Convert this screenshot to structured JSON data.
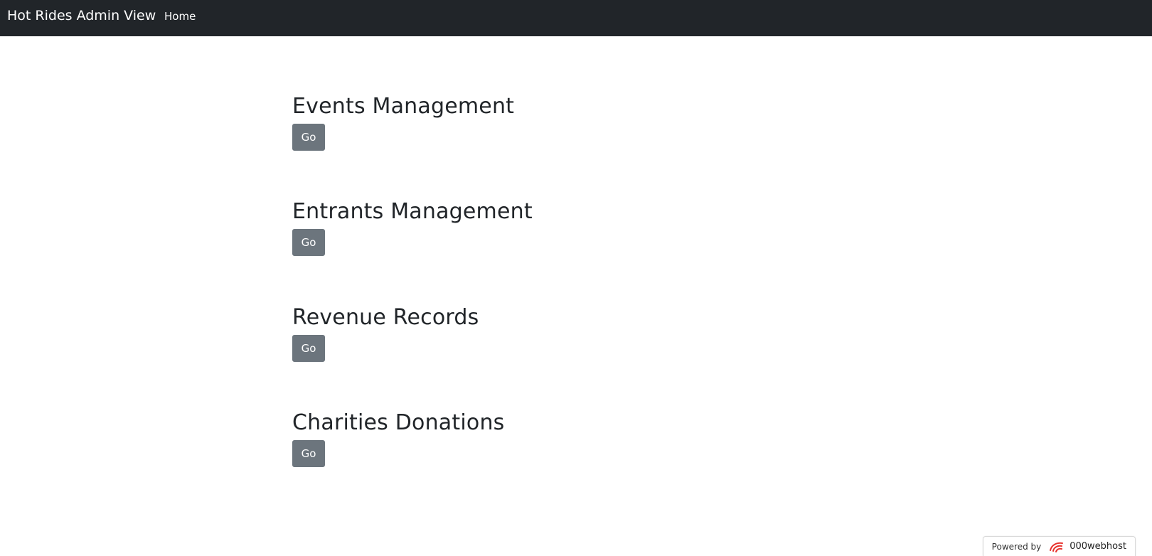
{
  "navbar": {
    "brand": "Hot Rides Admin View",
    "links": [
      {
        "label": "Home"
      }
    ]
  },
  "sections": [
    {
      "title": "Events Management",
      "button_label": "Go"
    },
    {
      "title": "Entrants Management",
      "button_label": "Go"
    },
    {
      "title": "Revenue Records",
      "button_label": "Go"
    },
    {
      "title": "Charities Donations",
      "button_label": "Go"
    }
  ],
  "footer_badge": {
    "prefix": "Powered by",
    "brand": "000webhost",
    "icon": "000webhost-logo-icon"
  },
  "colors": {
    "navbar_bg": "#212529",
    "button_bg": "#6c757d",
    "logo_red": "#e8322d"
  }
}
